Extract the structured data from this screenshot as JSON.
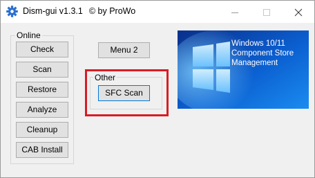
{
  "window": {
    "title": "Dism-gui v1.3.1",
    "author": "© by ProWo",
    "icon": "gear-icon",
    "controls": [
      "minimize-icon",
      "maximize-icon",
      "close-icon"
    ]
  },
  "online_group": {
    "label": "Online",
    "buttons": [
      "Check",
      "Scan",
      "Restore",
      "Analyze",
      "Cleanup",
      "CAB Install"
    ]
  },
  "menu2_button": "Menu 2",
  "other_group": {
    "label": "Other",
    "sfc_button": "SFC Scan"
  },
  "banner": {
    "line1": "Windows 10/11",
    "line2": "Component Store",
    "line3": "Management",
    "logo": "windows-logo-icon"
  },
  "colors": {
    "highlight": "#d81c24",
    "banner_blue": "#0a4fb5",
    "focus_border": "#0078d7"
  }
}
